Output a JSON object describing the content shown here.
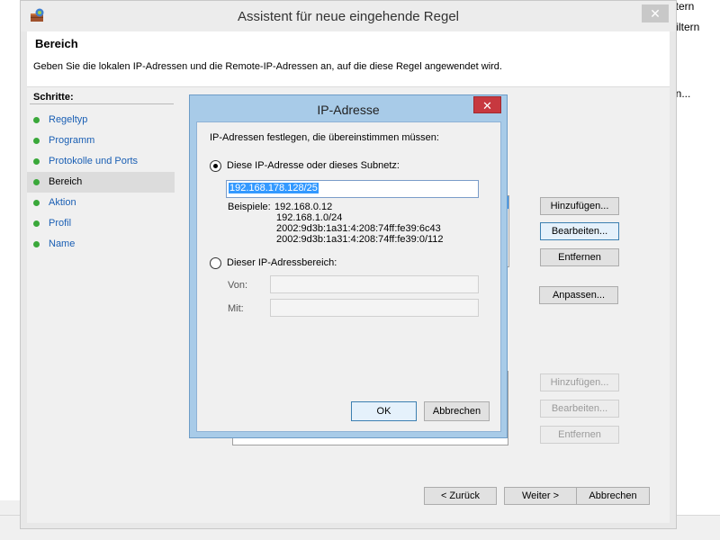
{
  "background": {
    "frag1": "ltern",
    "frag2": "Filtern",
    "frag3": "en..."
  },
  "wizard": {
    "title": "Assistent für neue eingehende Regel",
    "close_label": "✕",
    "header_title": "Bereich",
    "header_desc": "Geben Sie die lokalen IP-Adressen und die Remote-IP-Adressen an, auf die diese Regel angewendet wird.",
    "steps_label": "Schritte:",
    "steps": [
      {
        "label": "Regeltyp"
      },
      {
        "label": "Programm"
      },
      {
        "label": "Protokolle und Ports"
      },
      {
        "label": "Bereich"
      },
      {
        "label": "Aktion"
      },
      {
        "label": "Profil"
      },
      {
        "label": "Name"
      }
    ],
    "current_step": 3,
    "local_buttons": {
      "add": "Hinzufügen...",
      "edit": "Bearbeiten...",
      "remove": "Entfernen",
      "customize": "Anpassen..."
    },
    "remote_buttons": {
      "add": "Hinzufügen...",
      "edit": "Bearbeiten...",
      "remove": "Entfernen"
    },
    "nav": {
      "back": "< Zurück",
      "next": "Weiter >",
      "cancel": "Abbrechen"
    }
  },
  "ip_dialog": {
    "title": "IP-Adresse",
    "close_label": "✕",
    "instruction": "IP-Adressen festlegen, die übereinstimmen müssen:",
    "option_subnet": "Diese IP-Adresse oder dieses Subnetz:",
    "subnet_value": "192.168.178.128/25",
    "examples_label": "Beispiele:",
    "examples": [
      "192.168.0.12",
      "192.168.1.0/24",
      "2002:9d3b:1a31:4:208:74ff:fe39:6c43",
      "2002:9d3b:1a31:4:208:74ff:fe39:0/112"
    ],
    "option_range": "Dieser IP-Adressbereich:",
    "from_label": "Von:",
    "to_label": "Mit:",
    "ok_label": "OK",
    "cancel_label": "Abbrechen",
    "selected_option": "subnet"
  }
}
